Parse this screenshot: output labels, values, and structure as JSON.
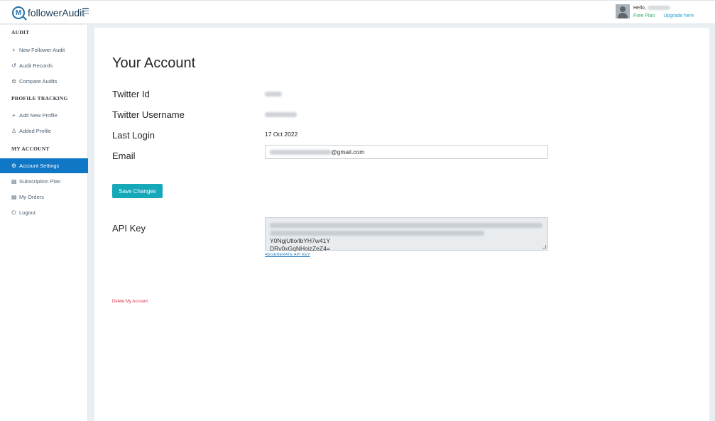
{
  "header": {
    "logo_letter": "M",
    "logo_text": "followerAudit",
    "hello": "Hello,",
    "plan": "Free Plan",
    "upgrade": "Upgrade here"
  },
  "sidebar": {
    "sections": [
      {
        "title": "AUDIT"
      },
      {
        "title": "PROFILE TRACKING"
      },
      {
        "title": "MY ACCOUNT"
      }
    ],
    "items": [
      {
        "label": "New Follower Audit",
        "icon": "plus-icon"
      },
      {
        "label": "Audit Records",
        "icon": "history-icon"
      },
      {
        "label": "Compare Audits",
        "icon": "compare-icon"
      },
      {
        "label": "Add New Profile",
        "icon": "plus-icon"
      },
      {
        "label": "Added Profile",
        "icon": "user-icon"
      },
      {
        "label": "Account Settings",
        "icon": "user-gear-icon",
        "active": true
      },
      {
        "label": "Subscription Plan",
        "icon": "document-icon"
      },
      {
        "label": "My Orders",
        "icon": "document-icon"
      },
      {
        "label": "Logout",
        "icon": "power-icon"
      }
    ]
  },
  "main": {
    "title": "Your Account",
    "fields": {
      "twitter_id_label": "Twitter Id",
      "twitter_username_label": "Twitter Username",
      "last_login_label": "Last Login",
      "last_login_value": "17 Oct 2022",
      "email_label": "Email",
      "email_suffix": "@gmail.com",
      "api_key_label": "API Key",
      "api_key_visible_tail": "Y0NgjUtlo/lbYH7w41Y",
      "api_key_line2": "DRv0xGqNHoizZeZ4="
    },
    "save_button": "Save Changes",
    "regenerate_link": "REGENERATE API KEY",
    "delete_link": "Delete My Account"
  },
  "colors": {
    "accent": "#0f77c6",
    "button": "#14a8b8",
    "plan": "#3aa96a",
    "upgrade": "#2a9fd6",
    "danger": "#d2314a"
  }
}
